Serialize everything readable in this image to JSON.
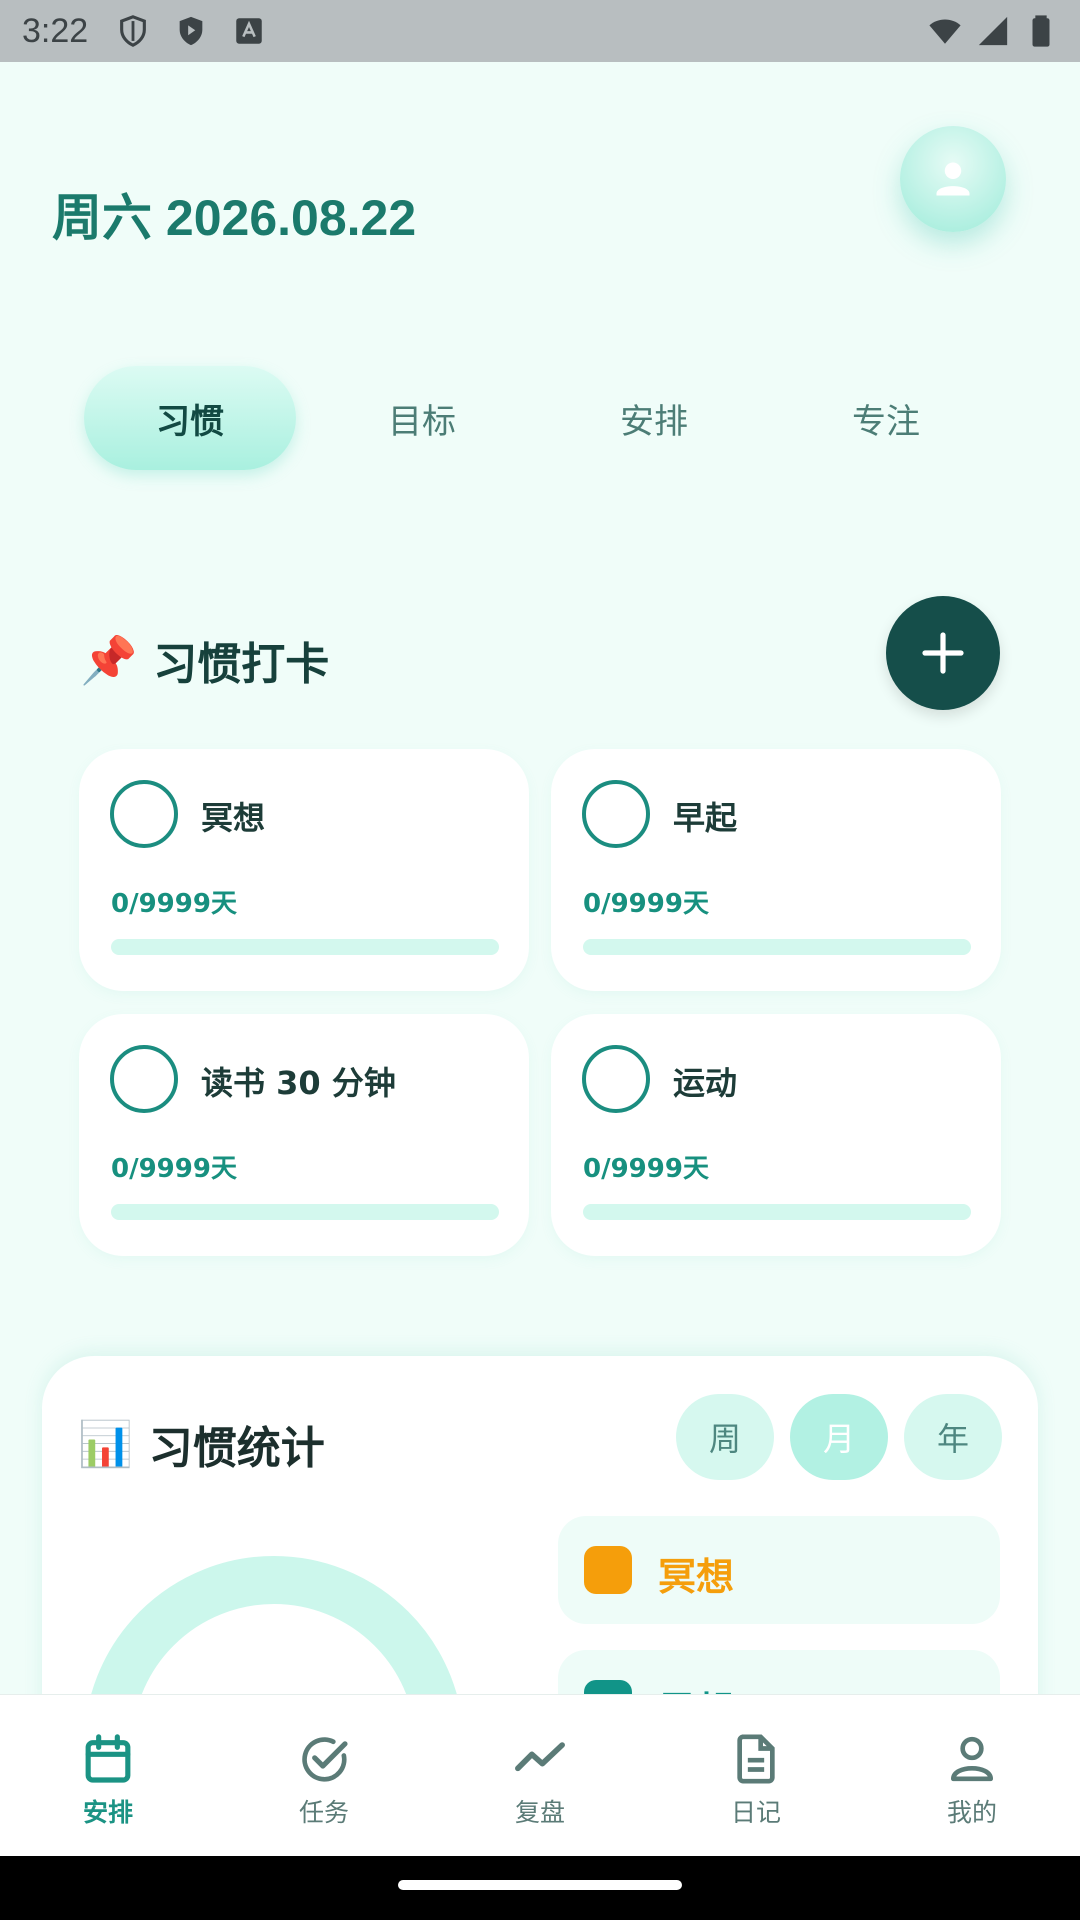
{
  "status_bar": {
    "time": "3:22"
  },
  "header": {
    "title": "周六 2026.08.22"
  },
  "tabs": [
    {
      "label": "习惯",
      "active": true
    },
    {
      "label": "目标",
      "active": false
    },
    {
      "label": "安排",
      "active": false
    },
    {
      "label": "专注",
      "active": false
    }
  ],
  "habits_section": {
    "emoji": "📌",
    "title": "习惯打卡"
  },
  "habits": [
    {
      "name": "冥想",
      "progress_text": "0/9999天",
      "progress": 0
    },
    {
      "name": "早起",
      "progress_text": "0/9999天",
      "progress": 0
    },
    {
      "name": "读书 30 分钟",
      "progress_text": "0/9999天",
      "progress": 0
    },
    {
      "name": "运动",
      "progress_text": "0/9999天",
      "progress": 0
    }
  ],
  "stats": {
    "emoji": "📊",
    "title": "习惯统计",
    "periods": [
      {
        "label": "周",
        "active": false
      },
      {
        "label": "月",
        "active": true
      },
      {
        "label": "年",
        "active": false
      }
    ],
    "legend": [
      {
        "label": "冥想",
        "color": "#f59e0b"
      },
      {
        "label": "早起",
        "color": "#119488"
      }
    ]
  },
  "bottom_nav": [
    {
      "label": "安排",
      "icon": "calendar-icon",
      "active": true
    },
    {
      "label": "任务",
      "icon": "check-circle-icon",
      "active": false
    },
    {
      "label": "复盘",
      "icon": "trend-icon",
      "active": false
    },
    {
      "label": "日记",
      "icon": "document-icon",
      "active": false
    },
    {
      "label": "我的",
      "icon": "person-icon",
      "active": false
    }
  ],
  "colors": {
    "accent": "#1b9384",
    "title": "#1b7a6c",
    "dark_button": "#154e4a",
    "background": "#f0fdf9"
  }
}
